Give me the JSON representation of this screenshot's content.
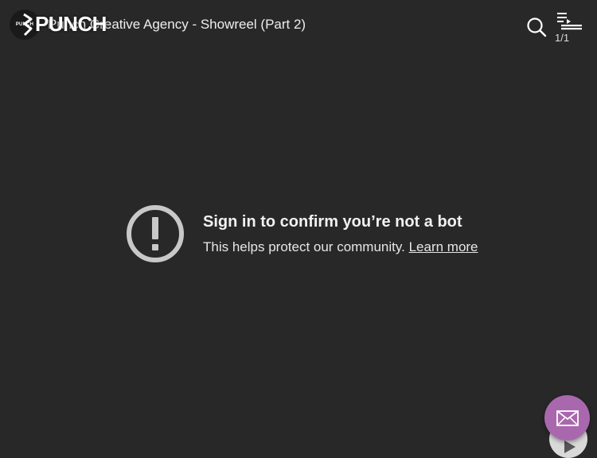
{
  "header": {
    "channel_avatar_text": "PUNCH",
    "video_title": "Punch Creative Agency - Showreel (Part 2)",
    "brand_logo_text": "PUNCH",
    "playlist_count": "1/1"
  },
  "error": {
    "heading": "Sign in to confirm you’re not a bot",
    "message": "This helps protect our community.",
    "learn_more": "Learn more"
  },
  "icons": {
    "search": "search-icon",
    "playlist": "playlist-icon",
    "error": "exclamation-circle-icon",
    "mail": "mail-icon",
    "play": "play-icon"
  },
  "colors": {
    "background": "#282828",
    "mail_button": "#a968ad"
  }
}
